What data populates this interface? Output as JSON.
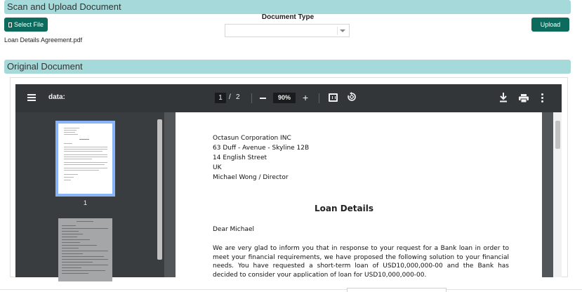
{
  "upload_section": {
    "title": "Scan and Upload Document",
    "select_file_label": "Select File",
    "document_type_label": "Document Type",
    "document_type_value": "",
    "upload_label": "Upload",
    "file_name": "Loan Details Agreement.pdf"
  },
  "original_section": {
    "title": "Original Document"
  },
  "pdf_viewer": {
    "title": "data:",
    "current_page": "1",
    "page_separator": "/",
    "total_pages": "2",
    "zoom": "90%",
    "zoom_in_symbol": "+",
    "icons": [
      "menu-icon",
      "zoom-out-icon",
      "zoom-in-icon",
      "fit-page-icon",
      "rotate-icon",
      "download-icon",
      "print-icon",
      "more-icon"
    ],
    "thumbnail_label": "1",
    "colors": {
      "toolbar": "#323639",
      "sidebar": "#3a3d40",
      "canvas": "#525659",
      "thumbnail_highlight": "#8ab4f8"
    }
  },
  "document": {
    "address_lines": [
      "Octasun Corporation INC",
      "63 Duff - Avenue - Skyline 12B",
      "14 English Street",
      "UK",
      "Michael Wong / Director"
    ],
    "heading": "Loan Details",
    "salutation": "Dear Michael",
    "paragraph": "We are very glad to inform you that in response to your request for a Bank loan in order to meet your financial requirements, we have proposed the following solution to your financial needs. You have requested a short-term loan of USD10,000,000-00 and the Bank has decided to consider your application of loan for USD10,000,000-00."
  },
  "colors": {
    "section_header": "#a6d9d9",
    "button": "#0c6b5c"
  }
}
